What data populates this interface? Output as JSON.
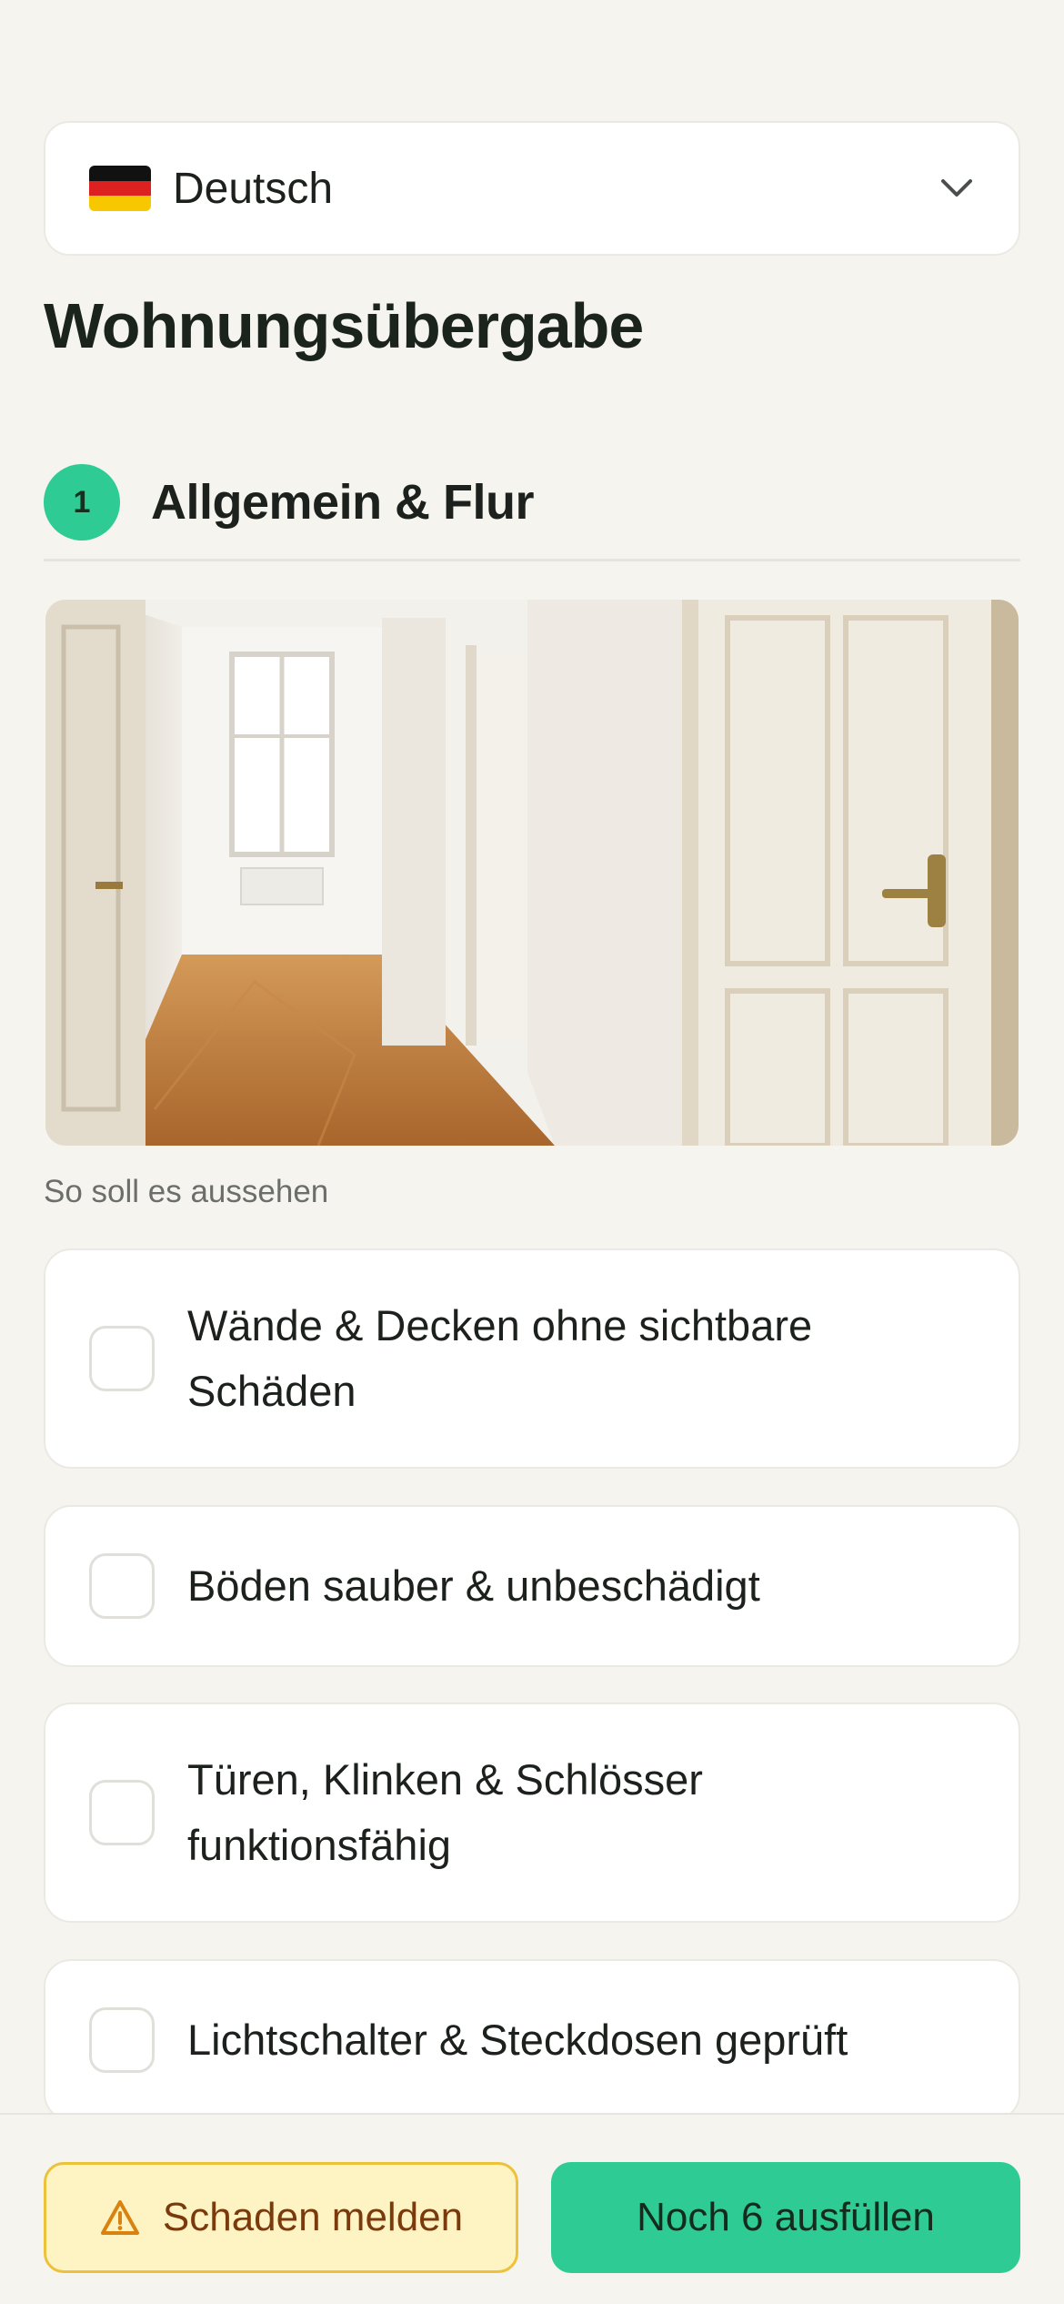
{
  "language": {
    "selected": "Deutsch",
    "flag_icon": "germany-flag-icon",
    "chevron_icon": "chevron-down-icon"
  },
  "page": {
    "title": "Wohnungsübergabe"
  },
  "section": {
    "number": "1",
    "title": "Allgemein & Flur",
    "image_caption": "So soll es aussehen"
  },
  "checklist": {
    "items": [
      {
        "label_line1": "Wände & Decken ohne sichtbare",
        "label_line2": "Schäden",
        "checked": false
      },
      {
        "label_line1": "Böden sauber & unbeschädigt",
        "label_line2": "",
        "checked": false
      },
      {
        "label_line1": "Türen, Klinken & Schlösser",
        "label_line2": "funktionsfähig",
        "checked": false
      },
      {
        "label_line1": "Lichtschalter & Steckdosen geprüft",
        "label_line2": "",
        "checked": false
      }
    ]
  },
  "actions": {
    "report_damage": "Schaden melden",
    "remaining": "Noch 6 ausfüllen"
  },
  "colors": {
    "accent": "#2ecb94",
    "background": "#f5f4ef",
    "warning_bg": "#fef3c3",
    "warning_border": "#ecc23a",
    "warning_text": "#7a3a0c"
  }
}
